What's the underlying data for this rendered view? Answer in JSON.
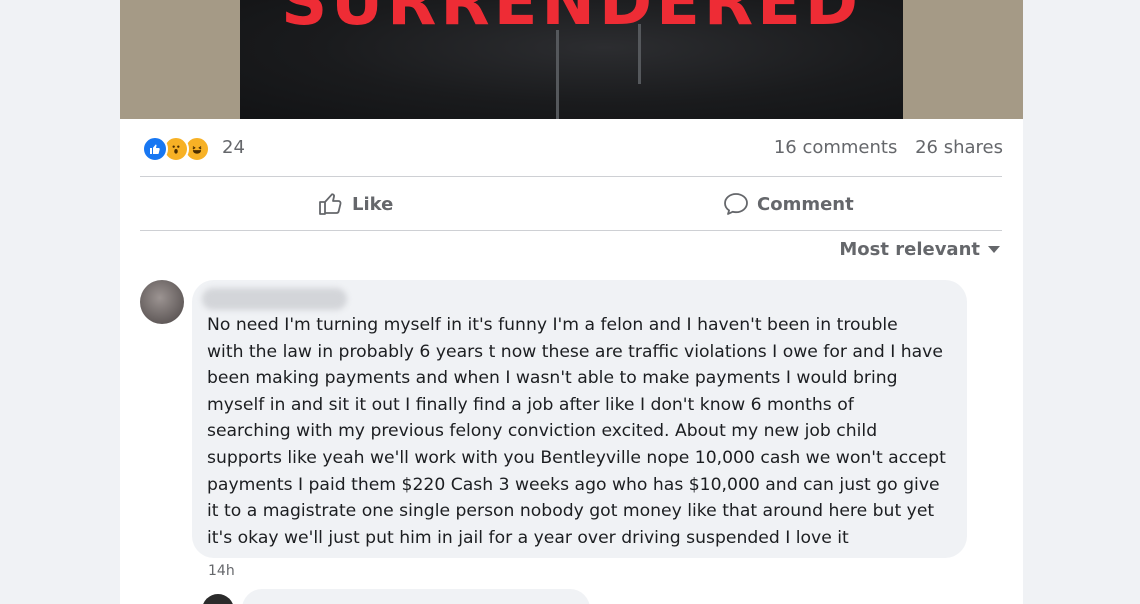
{
  "post": {
    "image_title": "SURRENDERED"
  },
  "reactions": {
    "icons": [
      "like-icon",
      "wow-icon",
      "haha-icon"
    ],
    "count": "24"
  },
  "stats": {
    "comments": "16 comments",
    "shares": "26 shares"
  },
  "actions": {
    "like_label": "Like",
    "comment_label": "Comment"
  },
  "sort": {
    "label": "Most relevant"
  },
  "comment": {
    "text": "No need I'm turning myself in it's funny I'm a felon and I haven't been in trouble\nwith the law in probably 6 years t now these are traffic violations I owe for and I have\nbeen making payments and when I wasn't able to make payments I would bring\nmyself in and sit it out I finally find a job after like I don't know 6 months of\nsearching with my previous felony conviction excited. About my new job child\nsupports like yeah we'll work with you Bentleyville nope 10,000 cash we won't accept\npayments I paid them $220 Cash 3 weeks ago who has $10,000 and can just go give\nit to a magistrate one single person nobody got money like that around here but yet\nit's okay we'll just put him in jail for a year over driving suspended I love it",
    "time": "14h"
  },
  "colors": {
    "accent_red": "#ee2c35",
    "like_blue": "#1877f2",
    "reaction_yellow": "#f7b125",
    "muted_text": "#65676b"
  }
}
